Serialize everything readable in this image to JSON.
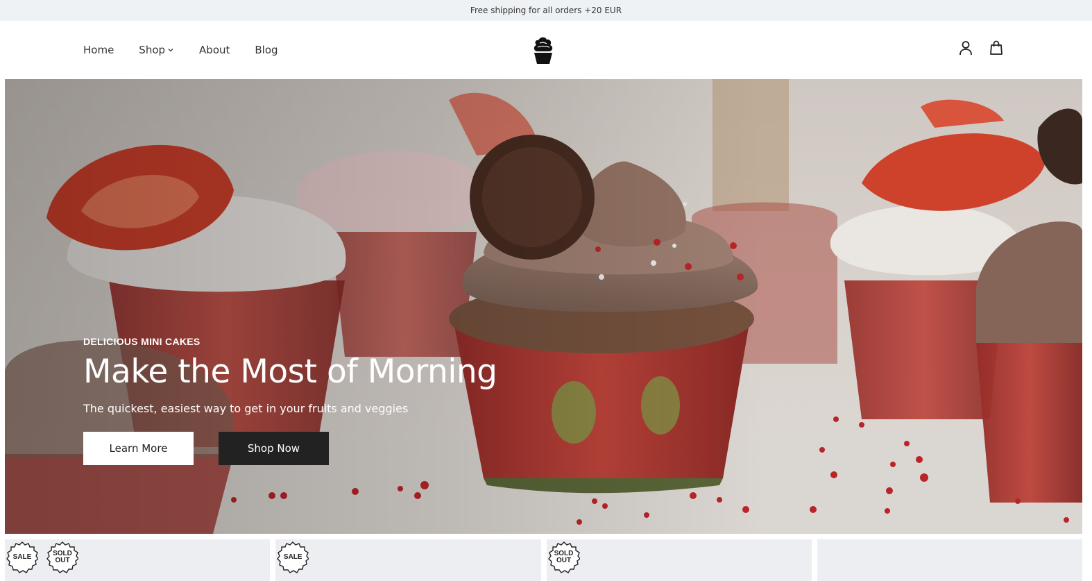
{
  "announcement": "Free shipping for all orders +20 EUR",
  "nav": {
    "home": "Home",
    "shop": "Shop",
    "about": "About",
    "blog": "Blog"
  },
  "icons": {
    "logo": "cupcake-logo",
    "account": "user-icon",
    "cart": "shopping-bag-icon",
    "shop_dropdown": "chevron-down-icon"
  },
  "hero": {
    "eyebrow": "DELICIOUS MINI CAKES",
    "title": "Make the Most of Morning",
    "subtitle": "The quickest, easiest way to get in your fruits and veggies",
    "primary_button": "Learn More",
    "secondary_button": "Shop Now"
  },
  "product_cards": [
    {
      "badges": [
        "SALE",
        "SOLD OUT"
      ]
    },
    {
      "badges": [
        "SALE"
      ]
    },
    {
      "badges": [
        "SOLD OUT"
      ]
    },
    {
      "badges": []
    }
  ],
  "colors": {
    "announcement_bg": "#eff2f4",
    "dark_button": "#222222",
    "card_bg": "#eceef2"
  }
}
